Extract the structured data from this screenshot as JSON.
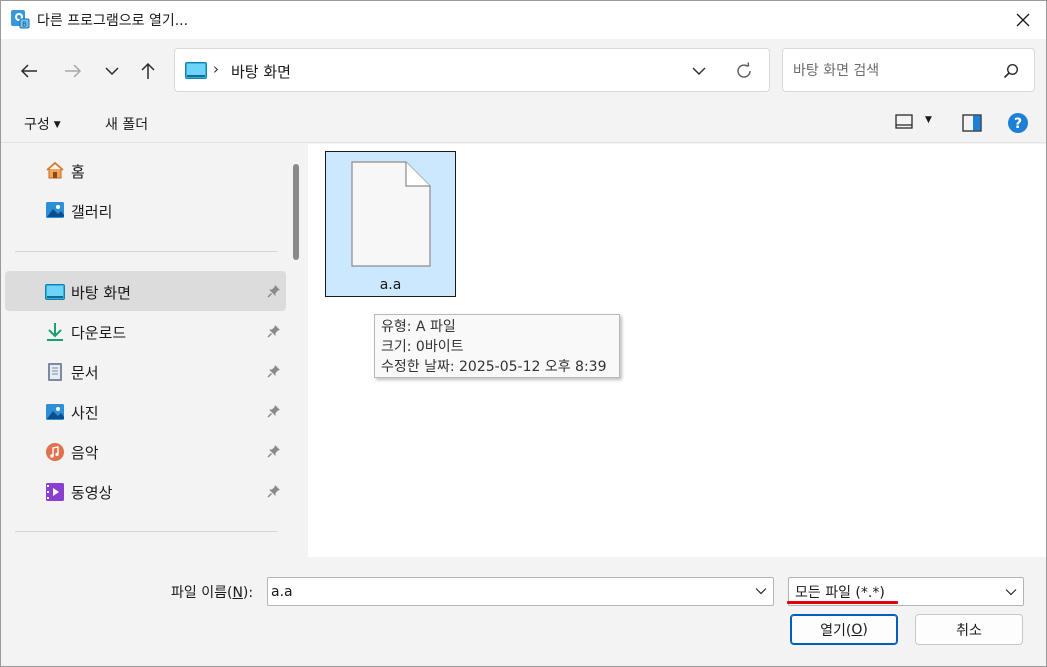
{
  "window": {
    "title": "다른 프로그램으로 열기..."
  },
  "address": {
    "path": "바탕 화면"
  },
  "search": {
    "placeholder": "바탕 화면 검색"
  },
  "toolbar": {
    "organize_label": "구성",
    "new_folder_label": "새 폴더"
  },
  "sidebar": {
    "items": [
      {
        "label": "홈",
        "icon": "home-icon"
      },
      {
        "label": "갤러리",
        "icon": "gallery-icon"
      },
      {
        "label": "바탕 화면",
        "icon": "desktop-icon",
        "selected": true,
        "pinned": true
      },
      {
        "label": "다운로드",
        "icon": "download-icon",
        "pinned": true
      },
      {
        "label": "문서",
        "icon": "document-icon",
        "pinned": true
      },
      {
        "label": "사진",
        "icon": "pictures-icon",
        "pinned": true
      },
      {
        "label": "음악",
        "icon": "music-icon",
        "pinned": true
      },
      {
        "label": "동영상",
        "icon": "video-icon",
        "pinned": true
      }
    ]
  },
  "content": {
    "files": [
      {
        "name": "a.a",
        "icon": "blank-file-icon",
        "selected": true
      }
    ],
    "tooltip": {
      "type_line": "유형: A 파일",
      "size_line": "크기: 0바이트",
      "modified_line": "수정한 날짜: 2025-05-12 오후 8:39"
    }
  },
  "bottom": {
    "filename_label_pre": "파일 이름(",
    "filename_label_key": "N",
    "filename_label_post": "):",
    "filename_value": "a.a",
    "filetype_value": "모든 파일 (*.*)",
    "open_label_pre": "열기(",
    "open_label_key": "O",
    "open_label_post": ")",
    "cancel_label": "취소"
  },
  "colors": {
    "accent": "#005fb8",
    "selection": "#cce8ff",
    "annotation": "#e0000a"
  }
}
